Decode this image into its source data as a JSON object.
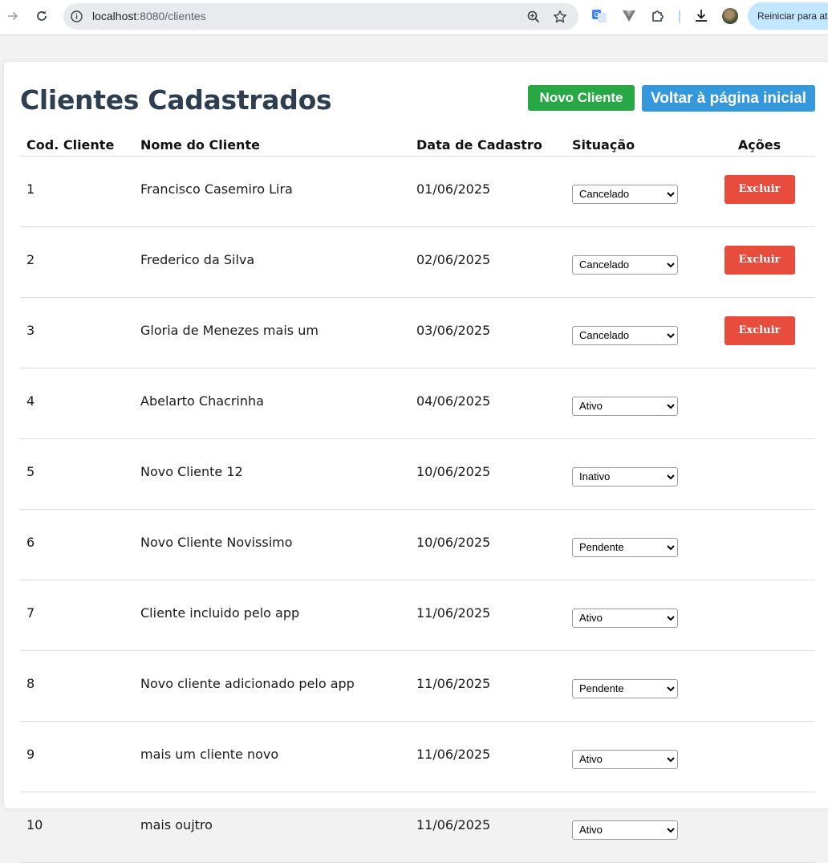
{
  "browser": {
    "url_host": "localhost",
    "url_path": ":8080/clientes",
    "restart_label": "Reiniciar para atu"
  },
  "page": {
    "title": "Clientes Cadastrados",
    "new_client_label": "Novo Cliente",
    "back_home_label": "Voltar à página inicial"
  },
  "colors": {
    "title": "#2c3e50",
    "new_button": "#28a745",
    "back_button": "#3498db",
    "delete_button": "#e74c3c"
  },
  "table": {
    "headers": [
      "Cod. Cliente",
      "Nome do Cliente",
      "Data de Cadastro",
      "Situação",
      "Ações"
    ],
    "delete_label": "Excluir",
    "rows": [
      {
        "id": "1",
        "name": "Francisco Casemiro Lira",
        "date": "01/06/2025",
        "status": "Cancelado",
        "deletable": true
      },
      {
        "id": "2",
        "name": "Frederico da Silva",
        "date": "02/06/2025",
        "status": "Cancelado",
        "deletable": true
      },
      {
        "id": "3",
        "name": "Gloria de Menezes mais um",
        "date": "03/06/2025",
        "status": "Cancelado",
        "deletable": true
      },
      {
        "id": "4",
        "name": "Abelarto Chacrinha",
        "date": "04/06/2025",
        "status": "Ativo",
        "deletable": false
      },
      {
        "id": "5",
        "name": "Novo Cliente 12",
        "date": "10/06/2025",
        "status": "Inativo",
        "deletable": false
      },
      {
        "id": "6",
        "name": "Novo Cliente Novissimo",
        "date": "10/06/2025",
        "status": "Pendente",
        "deletable": false
      },
      {
        "id": "7",
        "name": "Cliente incluido pelo app",
        "date": "11/06/2025",
        "status": "Ativo",
        "deletable": false
      },
      {
        "id": "8",
        "name": "Novo cliente adicionado pelo app",
        "date": "11/06/2025",
        "status": "Pendente",
        "deletable": false
      },
      {
        "id": "9",
        "name": "mais um cliente novo",
        "date": "11/06/2025",
        "status": "Ativo",
        "deletable": false
      },
      {
        "id": "10",
        "name": "mais oujtro",
        "date": "11/06/2025",
        "status": "Ativo",
        "deletable": false
      }
    ]
  }
}
